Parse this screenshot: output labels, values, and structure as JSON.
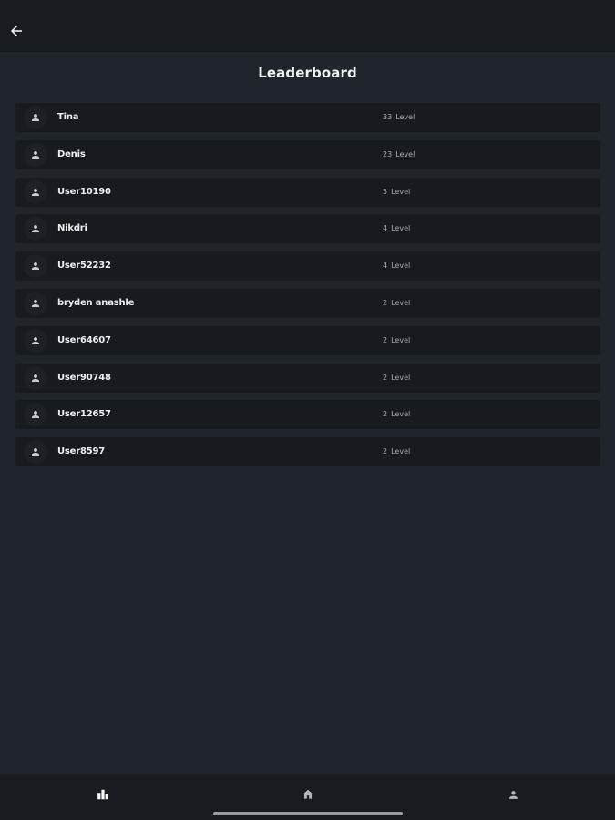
{
  "header": {
    "back_icon": "arrow-left-icon"
  },
  "page": {
    "title": "Leaderboard"
  },
  "leaderboard": {
    "level_label": "Level",
    "avatar_icon": "person-icon",
    "entries": [
      {
        "name": "Tina",
        "level": "33"
      },
      {
        "name": "Denis",
        "level": "23"
      },
      {
        "name": "User10190",
        "level": "5"
      },
      {
        "name": "Nikdri",
        "level": "4"
      },
      {
        "name": "User52232",
        "level": "4"
      },
      {
        "name": "bryden anashle",
        "level": "2"
      },
      {
        "name": "User64607",
        "level": "2"
      },
      {
        "name": "User90748",
        "level": "2"
      },
      {
        "name": "User12657",
        "level": "2"
      },
      {
        "name": "User8597",
        "level": "2"
      }
    ]
  },
  "bottom_nav": {
    "items": [
      {
        "icon": "leaderboard-icon",
        "active": true
      },
      {
        "icon": "home-icon",
        "active": false
      },
      {
        "icon": "profile-icon",
        "active": false
      }
    ]
  },
  "colors": {
    "background": "#20242b",
    "bar": "#181b1f",
    "row": "#171a1e",
    "active_nav": "#ffffff",
    "inactive_nav": "#b4b7bd"
  }
}
